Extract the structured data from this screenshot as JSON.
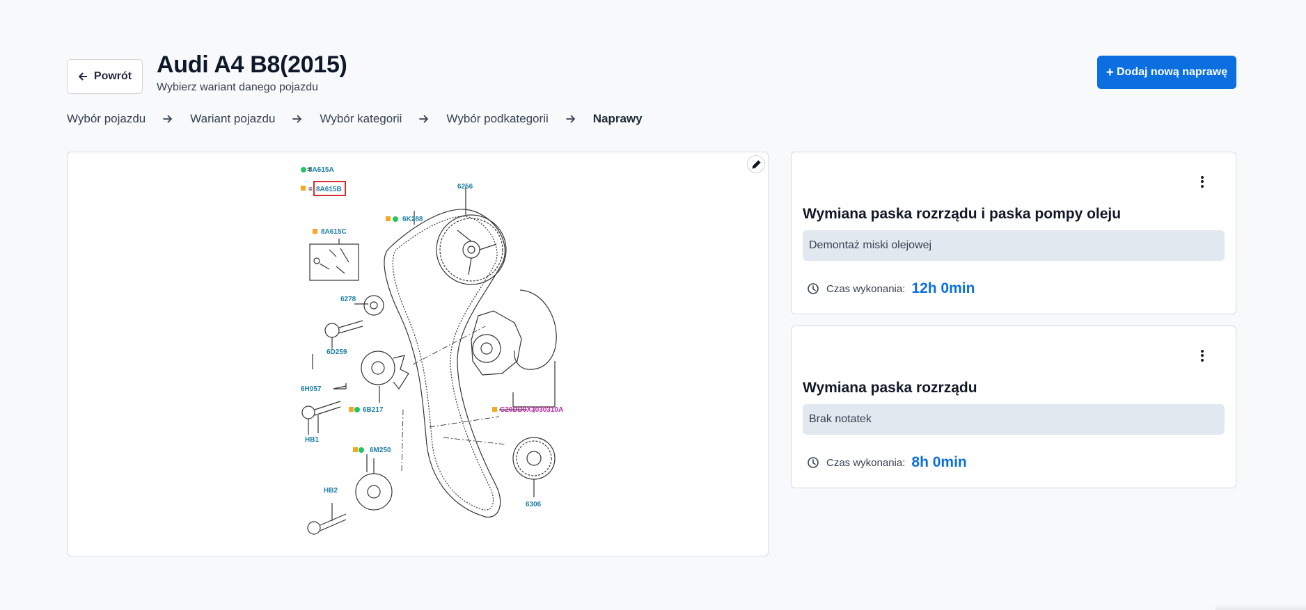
{
  "header": {
    "back_label": "Powrót",
    "title": "Audi A4 B8(2015)",
    "subtitle": "Wybierz wariant danego pojazdu",
    "add_button_label": "Dodaj nową naprawę"
  },
  "breadcrumb": [
    {
      "label": "Wybór pojazdu"
    },
    {
      "label": "Wariant pojazdu"
    },
    {
      "label": "Wybór kategorii"
    },
    {
      "label": "Wybór podkategorii"
    },
    {
      "label": "Naprawy",
      "active": true
    }
  ],
  "diagram": {
    "labels": {
      "part_8a615a": "8A615A",
      "part_8a615b": "8A615B",
      "part_8a615c": "8A615C",
      "part_6256": "6256",
      "part_6k288": "6K288",
      "part_6278": "6278",
      "part_6d259": "6D259",
      "part_6h057": "6H057",
      "part_6b217": "6B217",
      "part_hb1": "HB1",
      "part_6m250": "6M250",
      "part_hb2": "HB2",
      "part_c20dd": "C20DD0X3030310A",
      "part_6306": "6306"
    }
  },
  "repairs": [
    {
      "title": "Wymiana paska rozrządu i paska pompy oleju",
      "note": "Demontaż miski olejowej",
      "time_label": "Czas wykonania:",
      "time_value": "12h 0min"
    },
    {
      "title": "Wymiana paska rozrządu",
      "note": "Brak notatek",
      "time_label": "Czas wykonania:",
      "time_value": "8h 0min"
    }
  ],
  "icons": {
    "back": "arrow-left-icon",
    "add": "plus-icon",
    "separator": "arrow-right-icon",
    "edit": "pencil-icon",
    "menu": "kebab-menu-icon",
    "time": "clock-icon"
  },
  "colors": {
    "primary": "#0b6fe0",
    "background": "#f7f9fb",
    "note_background": "#e2e8ef",
    "diagram_label": "#1b7ea8",
    "diagram_label_magenta": "#c026a8",
    "marker_green": "#22c55e",
    "marker_orange": "#f5a623",
    "highlight_red": "#d32f2f"
  }
}
